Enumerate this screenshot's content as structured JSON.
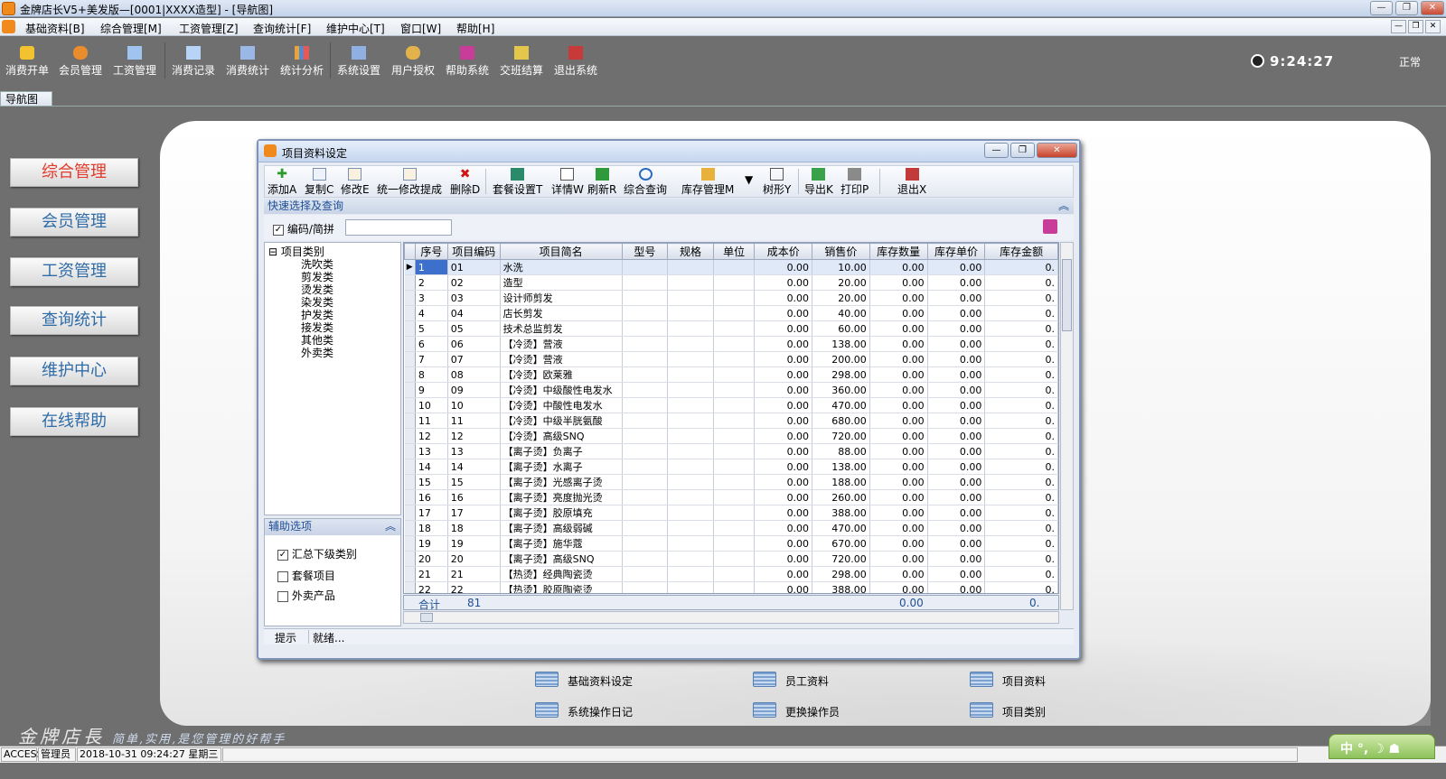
{
  "window": {
    "title": "金牌店长V5+美发版—[0001|XXXX造型] - [导航图]"
  },
  "menu": [
    "基础资料[B]",
    "综合管理[M]",
    "工资管理[Z]",
    "查询统计[F]",
    "维护中心[T]",
    "窗口[W]",
    "帮助[H]"
  ],
  "toolbar": {
    "items": [
      "消费开单",
      "会员管理",
      "工资管理",
      "消费记录",
      "消费统计",
      "统计分析",
      "系统设置",
      "用户授权",
      "帮助系统",
      "交班结算",
      "退出系统"
    ],
    "clock": "9:24:27",
    "state": "正常"
  },
  "nav_tab": "导航图",
  "left_nav": [
    "综合管理",
    "会员管理",
    "工资管理",
    "查询统计",
    "维护中心",
    "在线帮助"
  ],
  "links": [
    "基础资料设定",
    "员工资料",
    "项目资料",
    "系统操作日记",
    "更换操作员",
    "项目类别"
  ],
  "brand": {
    "name": "金牌店長",
    "slogan": "简单,实用,是您管理的好帮手"
  },
  "status_bar": {
    "db": "ACCESS",
    "user": "管理员",
    "datetime": "2018-10-31 09:24:27 星期三"
  },
  "ime": "中 °, ☽ ☗",
  "dialog": {
    "title": "项目资料设定",
    "toolbar": [
      "添加A",
      "复制C",
      "修改E",
      "统一修改提成",
      "删除D",
      "套餐设置T",
      "详情W",
      "刷新R",
      "综合查询",
      "库存管理M",
      "树形Y",
      "导出K",
      "打印P",
      "退出X"
    ],
    "quick_header": "快速选择及查询",
    "search_check_label": "编码/简拼",
    "search_value": "",
    "tree": {
      "root": "项目类别",
      "children": [
        "洗吹类",
        "剪发类",
        "烫发类",
        "染发类",
        "护发类",
        "接发类",
        "其他类",
        "外卖类"
      ]
    },
    "aux": {
      "header": "辅助选项",
      "options": [
        {
          "label": "汇总下级类别",
          "checked": true
        },
        {
          "label": "套餐项目",
          "checked": false
        },
        {
          "label": "外卖产品",
          "checked": false
        }
      ]
    },
    "columns": [
      "序号",
      "项目编码",
      "项目简名",
      "型号",
      "规格",
      "单位",
      "成本价",
      "销售价",
      "库存数量",
      "库存单价",
      "库存金额"
    ],
    "rows": [
      [
        "1",
        "01",
        "水洗",
        "0.00",
        "10.00",
        "0.00",
        "0.00",
        "0."
      ],
      [
        "2",
        "02",
        "造型",
        "0.00",
        "20.00",
        "0.00",
        "0.00",
        "0."
      ],
      [
        "3",
        "03",
        "设计师剪发",
        "0.00",
        "20.00",
        "0.00",
        "0.00",
        "0."
      ],
      [
        "4",
        "04",
        "店长剪发",
        "0.00",
        "40.00",
        "0.00",
        "0.00",
        "0."
      ],
      [
        "5",
        "05",
        "技术总监剪发",
        "0.00",
        "60.00",
        "0.00",
        "0.00",
        "0."
      ],
      [
        "6",
        "06",
        "【冷烫】营液",
        "0.00",
        "138.00",
        "0.00",
        "0.00",
        "0."
      ],
      [
        "7",
        "07",
        "【冷烫】营液",
        "0.00",
        "200.00",
        "0.00",
        "0.00",
        "0."
      ],
      [
        "8",
        "08",
        "【冷烫】欧莱雅",
        "0.00",
        "298.00",
        "0.00",
        "0.00",
        "0."
      ],
      [
        "9",
        "09",
        "【冷烫】中级酸性电发水",
        "0.00",
        "360.00",
        "0.00",
        "0.00",
        "0."
      ],
      [
        "10",
        "10",
        "【冷烫】中酸性电发水",
        "0.00",
        "470.00",
        "0.00",
        "0.00",
        "0."
      ],
      [
        "11",
        "11",
        "【冷烫】中级半胱氨酸",
        "0.00",
        "680.00",
        "0.00",
        "0.00",
        "0."
      ],
      [
        "12",
        "12",
        "【冷烫】高级SNQ",
        "0.00",
        "720.00",
        "0.00",
        "0.00",
        "0."
      ],
      [
        "13",
        "13",
        "【离子烫】负离子",
        "0.00",
        "88.00",
        "0.00",
        "0.00",
        "0."
      ],
      [
        "14",
        "14",
        "【离子烫】水离子",
        "0.00",
        "138.00",
        "0.00",
        "0.00",
        "0."
      ],
      [
        "15",
        "15",
        "【离子烫】光感离子烫",
        "0.00",
        "188.00",
        "0.00",
        "0.00",
        "0."
      ],
      [
        "16",
        "16",
        "【离子烫】亮度抛光烫",
        "0.00",
        "260.00",
        "0.00",
        "0.00",
        "0."
      ],
      [
        "17",
        "17",
        "【离子烫】胶原填充",
        "0.00",
        "388.00",
        "0.00",
        "0.00",
        "0."
      ],
      [
        "18",
        "18",
        "【离子烫】高级弱碱",
        "0.00",
        "470.00",
        "0.00",
        "0.00",
        "0."
      ],
      [
        "19",
        "19",
        "【离子烫】施华蔻",
        "0.00",
        "670.00",
        "0.00",
        "0.00",
        "0."
      ],
      [
        "20",
        "20",
        "【离子烫】高级SNQ",
        "0.00",
        "720.00",
        "0.00",
        "0.00",
        "0."
      ],
      [
        "21",
        "21",
        "【热烫】经典陶瓷烫",
        "0.00",
        "298.00",
        "0.00",
        "0.00",
        "0."
      ],
      [
        "22",
        "22",
        "【热烫】胶原陶瓷烫",
        "0.00",
        "388.00",
        "0.00",
        "0.00",
        "0."
      ]
    ],
    "total": {
      "label": "合计",
      "count": "81",
      "qty": "0.00",
      "amount": "0."
    },
    "status_label": "提示",
    "status_text": "就绪..."
  }
}
